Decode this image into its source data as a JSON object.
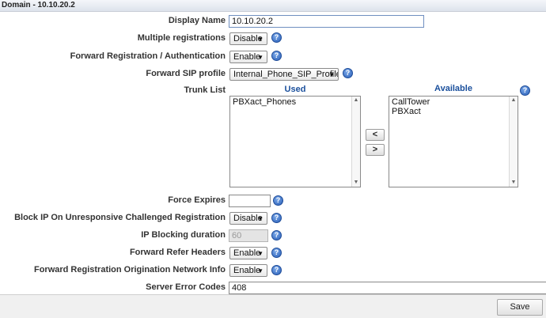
{
  "window": {
    "title": "Domain - 10.10.20.2"
  },
  "form": {
    "display_name": {
      "label": "Display Name",
      "value": "10.10.20.2"
    },
    "multiple_registrations": {
      "label": "Multiple registrations",
      "value": "Disable"
    },
    "forward_registration_auth": {
      "label": "Forward Registration / Authentication",
      "value": "Enable"
    },
    "forward_sip_profile": {
      "label": "Forward SIP profile",
      "value": "Internal_Phone_SIP_Profile"
    },
    "trunk_list": {
      "label": "Trunk List",
      "used_title": "Used",
      "available_title": "Available",
      "used": [
        "PBXact_Phones"
      ],
      "available": [
        "CallTower",
        "PBXact"
      ],
      "move_left": "<",
      "move_right": ">"
    },
    "force_expires": {
      "label": "Force Expires",
      "value": ""
    },
    "block_ip": {
      "label": "Block IP On Unresponsive Challenged Registration",
      "value": "Disable"
    },
    "ip_blocking_duration": {
      "label": "IP Blocking duration",
      "value": "60"
    },
    "forward_refer_headers": {
      "label": "Forward Refer Headers",
      "value": "Enable"
    },
    "forward_reg_origination": {
      "label": "Forward Registration Origination Network Info",
      "value": "Enable"
    },
    "server_error_codes": {
      "label": "Server Error Codes",
      "value": "408"
    }
  },
  "help_glyph": "?",
  "caret_glyph": "▼",
  "footer": {
    "save_label": "Save"
  },
  "icons": {
    "help": "help-icon",
    "caret": "chevron-down-icon"
  }
}
